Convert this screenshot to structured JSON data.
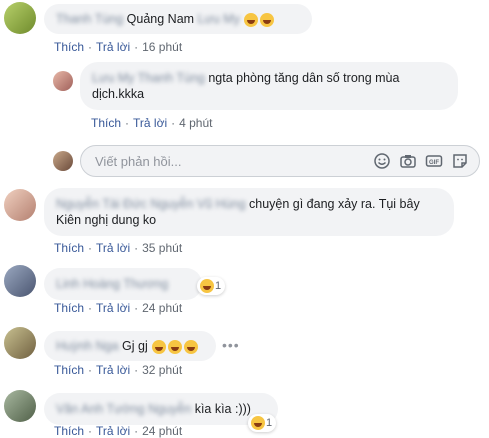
{
  "comments": [
    {
      "author": "Thanh Tùng",
      "mention": "Quảng Nam",
      "tag": "Lưu My",
      "text": "",
      "emoji": "😂😂",
      "time": "16 phút"
    },
    {
      "author": "Lưu My",
      "tag": "Thanh Tùng",
      "text": "ngta phòng tăng dân số trong mùa dịch.kkka",
      "time": "4 phút"
    },
    {
      "author": "Nguyễn Tài Đức",
      "tag": "Nguyễn Vũ Hùng",
      "text": "chuyện gì đang xảy ra. Tụi bây Kiên nghị dung ko",
      "time": "35 phút"
    },
    {
      "author": "Linh Hoàng Thương",
      "text": "",
      "time": "24 phút",
      "react_count": "1"
    },
    {
      "author": "Huỳnh Nga",
      "text": "Gj gj",
      "time": "32 phút"
    },
    {
      "author": "Văn Anh Tường",
      "tag": "Nguyễn",
      "text": "kìa kìa :)))",
      "time": "24 phút",
      "react_count": "1"
    }
  ],
  "labels": {
    "like": "Thích",
    "reply": "Trả lời",
    "dot": "·"
  },
  "reply_box": {
    "placeholder": "Viết phản hồi..."
  },
  "more": "•••"
}
